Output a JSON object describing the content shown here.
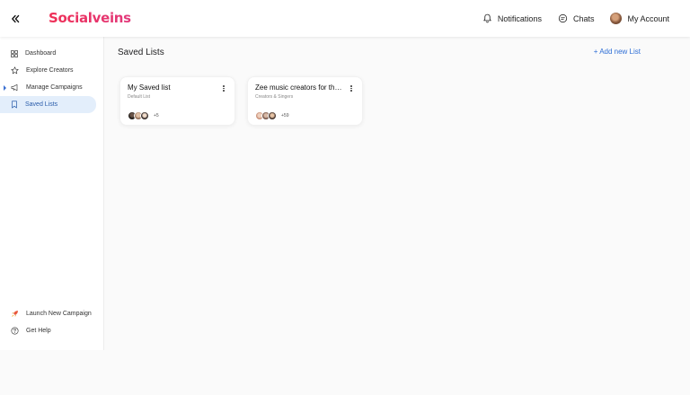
{
  "header": {
    "logo": "Socialveins",
    "notifications_label": "Notifications",
    "chats_label": "Chats",
    "account_label": "My Account"
  },
  "sidebar": {
    "items": [
      {
        "label": "Dashboard",
        "icon": "grid-icon"
      },
      {
        "label": "Explore Creators",
        "icon": "star-icon"
      },
      {
        "label": "Manage Campaigns",
        "icon": "megaphone-icon"
      },
      {
        "label": "Saved Lists",
        "icon": "bookmark-icon",
        "active": true
      }
    ],
    "bottom_items": [
      {
        "label": "Launch New Campaign",
        "icon": "rocket-icon"
      },
      {
        "label": "Get Help",
        "icon": "help-icon"
      }
    ]
  },
  "main": {
    "title": "Saved Lists",
    "add_label": "+ Add new List",
    "lists": [
      {
        "title": "My Saved list",
        "subtitle": "Default List",
        "more": "+5"
      },
      {
        "title": "Zee music creators for the song",
        "subtitle": "Creators & Singers",
        "more": "+59"
      }
    ]
  },
  "colors": {
    "brand": "#ea2f5c",
    "accent": "#2f6fd6",
    "active_bg": "#e3eefb"
  }
}
